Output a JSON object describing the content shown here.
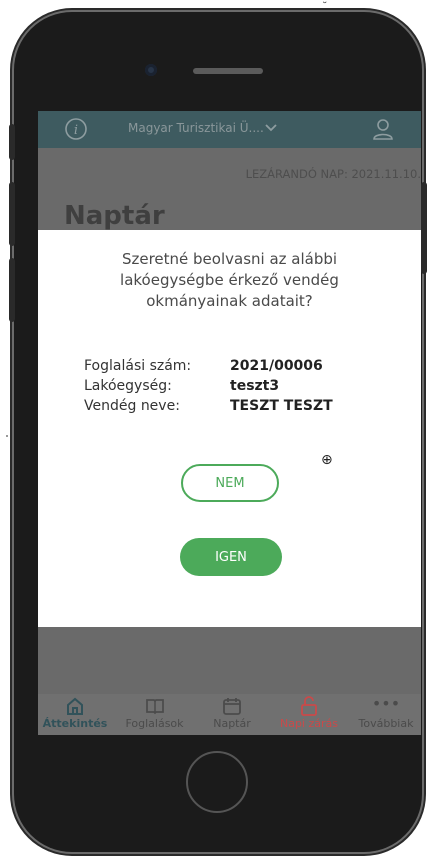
{
  "colors": {
    "header_bg": "#3e5b60",
    "accent_green": "#4caa5a",
    "danger_red": "#c94a4a",
    "overlay": "#6a6a6a"
  },
  "header": {
    "info_icon": "info-icon",
    "title": "Magyar Turisztikai Ü....",
    "chevron_icon": "chevron-down-icon",
    "user_icon": "user-icon"
  },
  "page": {
    "subtitle": "LEZÁRANDÓ NAP: 2021.11.10.",
    "title": "Naptár"
  },
  "dialog": {
    "question": "Szeretné beolvasni az alábbi lakóegységbe érkező vendég okmányainak adatait?",
    "question_lines": [
      "Szeretné beolvasni az alábbi",
      "lakóegységbe érkező vendég",
      "okmányainak adatait?"
    ],
    "fields": [
      {
        "label": "Foglalási szám:",
        "value": "2021/00006"
      },
      {
        "label": "Lakóegység:",
        "value": "teszt3"
      },
      {
        "label": "Vendég neve:",
        "value": "TESZT TESZT"
      }
    ],
    "no_label": "NEM",
    "yes_label": "IGEN"
  },
  "tabbar": {
    "items": [
      {
        "label": "Áttekintés",
        "icon": "home-icon",
        "active": true
      },
      {
        "label": "Foglalások",
        "icon": "book-icon"
      },
      {
        "label": "Naptár",
        "icon": "calendar-icon"
      },
      {
        "label": "Napi zárás",
        "icon": "lock-icon"
      },
      {
        "label": "Továbbiak",
        "icon": "more-icon"
      }
    ]
  }
}
